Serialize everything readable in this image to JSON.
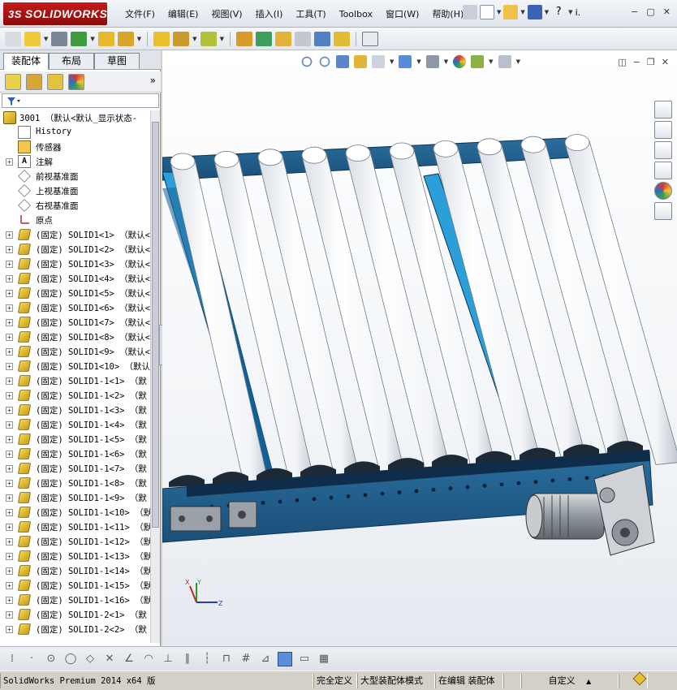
{
  "app": {
    "brand": "SOLIDWORKS",
    "brand_prefix": "3S"
  },
  "menu": {
    "items": [
      "文件(F)",
      "编辑(E)",
      "视图(V)",
      "插入(I)",
      "工具(T)",
      "Toolbox",
      "窗口(W)",
      "帮助(H)"
    ],
    "overflow": "i.",
    "help_icon": "?"
  },
  "panel": {
    "tabs": [
      "装配体",
      "布局",
      "草图"
    ],
    "active_tab": "装配体",
    "more": "»"
  },
  "tree": {
    "root": "3001 （默认<默认_显示状态-",
    "items": [
      {
        "label": "History",
        "icon": "history-icon",
        "expand": false
      },
      {
        "label": "传感器",
        "icon": "sensor-icon",
        "expand": false
      },
      {
        "label": "注解",
        "icon": "annotation-icon",
        "expand": true
      },
      {
        "label": "前视基准面",
        "icon": "plane-icon",
        "expand": false
      },
      {
        "label": "上视基准面",
        "icon": "plane-icon",
        "expand": false
      },
      {
        "label": "右视基准面",
        "icon": "plane-icon",
        "expand": false
      },
      {
        "label": "原点",
        "icon": "origin-icon",
        "expand": false
      },
      {
        "label": "(固定) SOLID1<1> （默认<",
        "icon": "part-icon",
        "expand": true
      },
      {
        "label": "(固定) SOLID1<2> （默认<",
        "icon": "part-icon",
        "expand": true
      },
      {
        "label": "(固定) SOLID1<3> （默认<",
        "icon": "part-icon",
        "expand": true
      },
      {
        "label": "(固定) SOLID1<4> （默认<",
        "icon": "part-icon",
        "expand": true
      },
      {
        "label": "(固定) SOLID1<5> （默认<",
        "icon": "part-icon",
        "expand": true
      },
      {
        "label": "(固定) SOLID1<6> （默认<",
        "icon": "part-icon",
        "expand": true
      },
      {
        "label": "(固定) SOLID1<7> （默认<",
        "icon": "part-icon",
        "expand": true
      },
      {
        "label": "(固定) SOLID1<8> （默认<",
        "icon": "part-icon",
        "expand": true
      },
      {
        "label": "(固定) SOLID1<9> （默认<",
        "icon": "part-icon",
        "expand": true
      },
      {
        "label": "(固定) SOLID1<10> （默认",
        "icon": "part-icon",
        "expand": true
      },
      {
        "label": "(固定) SOLID1-1<1> （默",
        "icon": "part-icon",
        "expand": true
      },
      {
        "label": "(固定) SOLID1-1<2> （默",
        "icon": "part-icon",
        "expand": true
      },
      {
        "label": "(固定) SOLID1-1<3> （默",
        "icon": "part-icon",
        "expand": true
      },
      {
        "label": "(固定) SOLID1-1<4> （默",
        "icon": "part-icon",
        "expand": true
      },
      {
        "label": "(固定) SOLID1-1<5> （默",
        "icon": "part-icon",
        "expand": true
      },
      {
        "label": "(固定) SOLID1-1<6> （默",
        "icon": "part-icon",
        "expand": true
      },
      {
        "label": "(固定) SOLID1-1<7> （默",
        "icon": "part-icon",
        "expand": true
      },
      {
        "label": "(固定) SOLID1-1<8> （默",
        "icon": "part-icon",
        "expand": true
      },
      {
        "label": "(固定) SOLID1-1<9> （默",
        "icon": "part-icon",
        "expand": true
      },
      {
        "label": "(固定) SOLID1-1<10> （默",
        "icon": "part-icon",
        "expand": true
      },
      {
        "label": "(固定) SOLID1-1<11> （默",
        "icon": "part-icon",
        "expand": true
      },
      {
        "label": "(固定) SOLID1-1<12> （默",
        "icon": "part-icon",
        "expand": true
      },
      {
        "label": "(固定) SOLID1-1<13> （默",
        "icon": "part-icon",
        "expand": true
      },
      {
        "label": "(固定) SOLID1-1<14> （默",
        "icon": "part-icon",
        "expand": true
      },
      {
        "label": "(固定) SOLID1-1<15> （默",
        "icon": "part-icon",
        "expand": true
      },
      {
        "label": "(固定) SOLID1-1<16> （默",
        "icon": "part-icon",
        "expand": true
      },
      {
        "label": "(固定) SOLID1-2<1> （默",
        "icon": "part-icon",
        "expand": true
      },
      {
        "label": "(固定) SOLID1-2<2> （默",
        "icon": "part-icon",
        "expand": true
      }
    ]
  },
  "triad": {
    "x": "X",
    "y": "Y",
    "z": "Z"
  },
  "status": {
    "product": "SolidWorks Premium 2014 x64 版",
    "fully_defined": "完全定义",
    "large_assembly": "大型装配体模式",
    "editing": "在编辑 装配体",
    "custom": "自定义"
  },
  "colors": {
    "frame_blue": "#1f5a86",
    "rail_cyan": "#2a9fd6",
    "roller_white": "#ffffff",
    "motor_grey": "#9aa0a6",
    "brand_red": "#b51414"
  }
}
